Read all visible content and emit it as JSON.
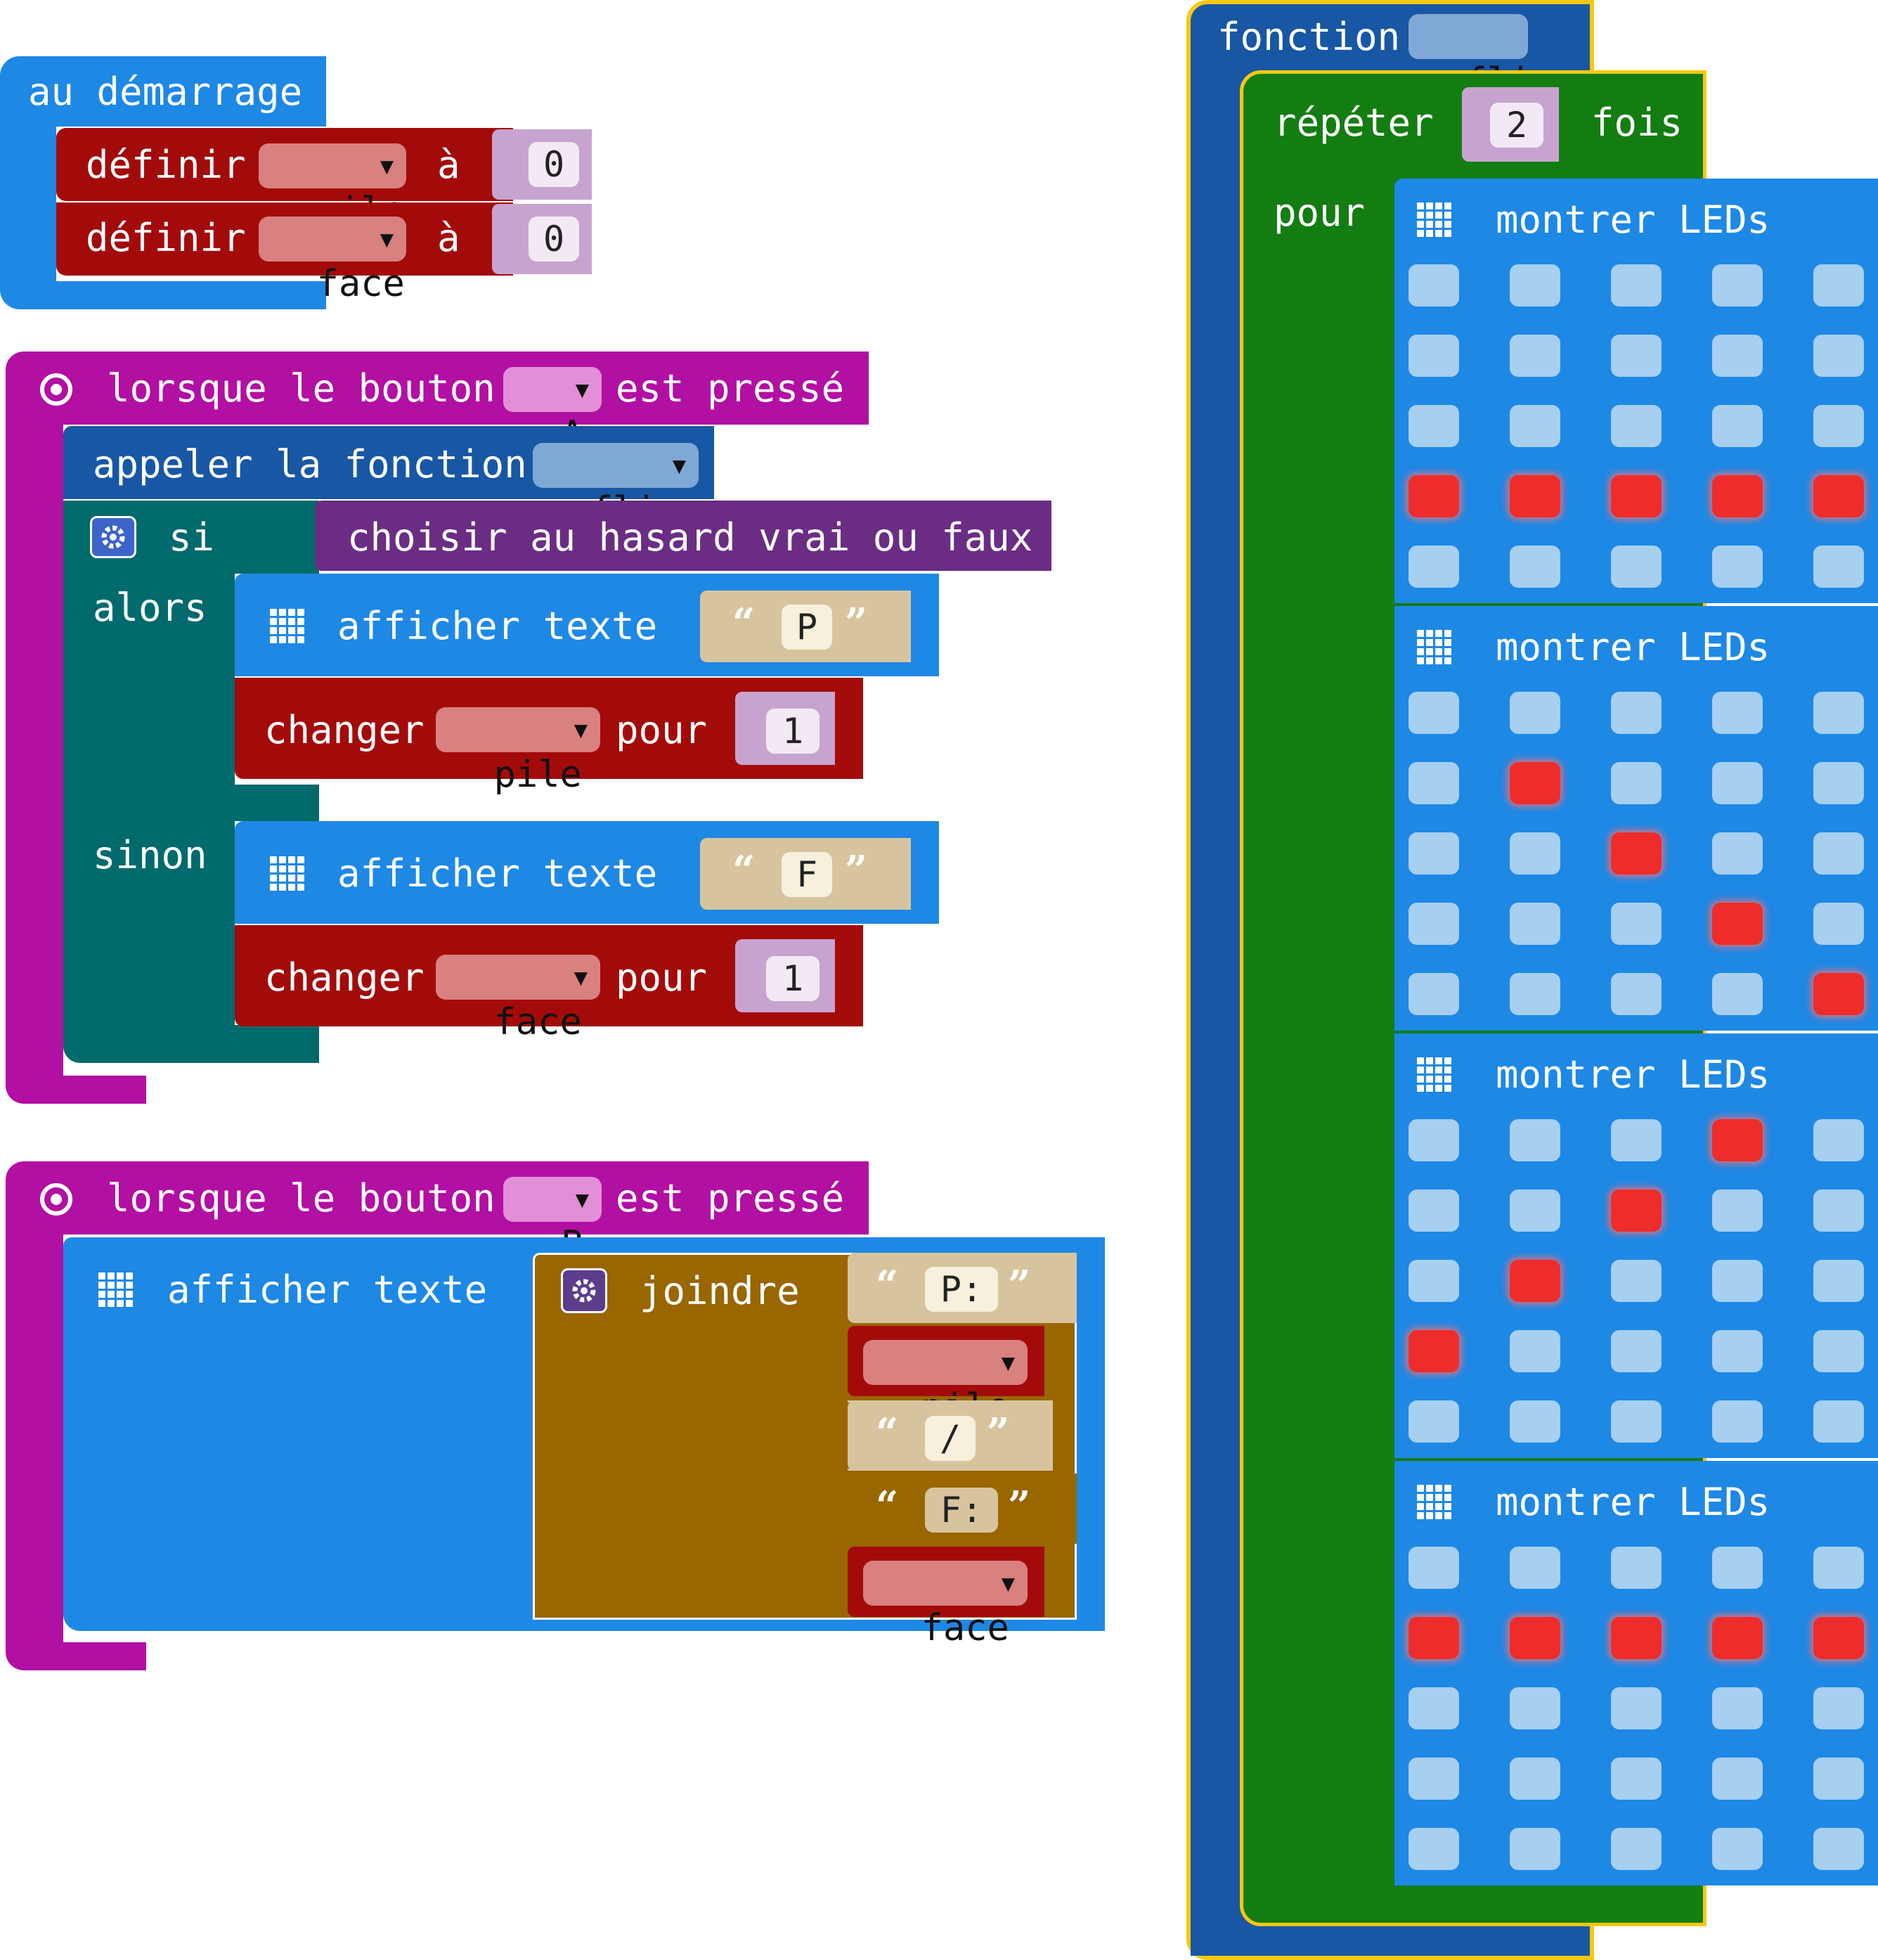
{
  "colors": {
    "basic_blue": "#1e88e5",
    "variables_red": "#a30b0b",
    "input_magenta": "#b20fa3",
    "logic_teal": "#006a6c",
    "loops_green": "#137d12",
    "functions_navy": "#1857a4",
    "text_brown": "#996600",
    "math_purple": "#6b2d83",
    "led_off": "#a6cff0",
    "led_on": "#ef2c2c",
    "highlight_yellow": "#f9c80e"
  },
  "on_start": {
    "label": "au démarrage",
    "rows": [
      {
        "set_label": "définir",
        "variable": "pile",
        "to_label": "à",
        "value": "0"
      },
      {
        "set_label": "définir",
        "variable": "face",
        "to_label": "à",
        "value": "0"
      }
    ]
  },
  "button_a": {
    "when_label": "lorsque le bouton",
    "button": "A",
    "pressed_label": "est pressé",
    "call_label": "appeler la fonction",
    "call_function": "flip",
    "if_label": "si",
    "condition": "choisir au hasard vrai ou faux",
    "then_label": "alors",
    "else_label": "sinon",
    "then_show_label": "afficher texte",
    "then_text": "P",
    "then_change_label": "changer",
    "then_change_var": "pile",
    "then_by_label": "pour",
    "then_by_value": "1",
    "else_show_label": "afficher texte",
    "else_text": "F",
    "else_change_label": "changer",
    "else_change_var": "face",
    "else_by_label": "pour",
    "else_by_value": "1"
  },
  "button_b": {
    "when_label": "lorsque le bouton",
    "button": "B",
    "pressed_label": "est pressé",
    "show_label": "afficher texte",
    "join_label": "joindre",
    "parts": {
      "p_text": "P:",
      "pile_var": "pile",
      "slash_text": "/",
      "f_text": "F:",
      "face_var": "face"
    }
  },
  "function_flip": {
    "function_label": "fonction",
    "name": "flip",
    "repeat_label": "répéter",
    "repeat_count": "2",
    "times_label": "fois",
    "do_label": "pour",
    "show_leds_label": "montrer LEDs",
    "frames": [
      [
        [
          0,
          0,
          0,
          0,
          0
        ],
        [
          0,
          0,
          0,
          0,
          0
        ],
        [
          0,
          0,
          0,
          0,
          0
        ],
        [
          1,
          1,
          1,
          1,
          1
        ],
        [
          0,
          0,
          0,
          0,
          0
        ]
      ],
      [
        [
          0,
          0,
          0,
          0,
          0
        ],
        [
          0,
          1,
          0,
          0,
          0
        ],
        [
          0,
          0,
          1,
          0,
          0
        ],
        [
          0,
          0,
          0,
          1,
          0
        ],
        [
          0,
          0,
          0,
          0,
          1
        ]
      ],
      [
        [
          0,
          0,
          0,
          1,
          0
        ],
        [
          0,
          0,
          1,
          0,
          0
        ],
        [
          0,
          1,
          0,
          0,
          0
        ],
        [
          1,
          0,
          0,
          0,
          0
        ],
        [
          0,
          0,
          0,
          0,
          0
        ]
      ],
      [
        [
          0,
          0,
          0,
          0,
          0
        ],
        [
          1,
          1,
          1,
          1,
          1
        ],
        [
          0,
          0,
          0,
          0,
          0
        ],
        [
          0,
          0,
          0,
          0,
          0
        ],
        [
          0,
          0,
          0,
          0,
          0
        ]
      ]
    ]
  }
}
